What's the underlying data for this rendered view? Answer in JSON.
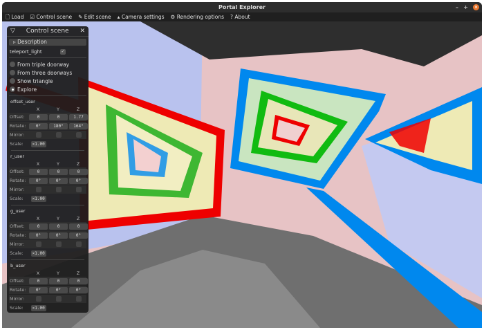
{
  "window": {
    "title": "Portal Explorer"
  },
  "menu": [
    {
      "icon": "file-icon",
      "label": "Load"
    },
    {
      "icon": "checkbox-icon",
      "label": "Control scene"
    },
    {
      "icon": "pencil-icon",
      "label": "Edit scene"
    },
    {
      "icon": "camera-icon",
      "label": "Camera settings"
    },
    {
      "icon": "gear-icon",
      "label": "Rendering options"
    },
    {
      "icon": "question-icon",
      "label": "About"
    }
  ],
  "panel": {
    "title": "Control scene",
    "description": "Description",
    "teleport_light": {
      "label": "teleport_light",
      "checked": true
    },
    "radios": [
      {
        "label": "From triple doorway",
        "selected": false
      },
      {
        "label": "From three doorways",
        "selected": false
      },
      {
        "label": "Show triangle",
        "selected": false
      },
      {
        "label": "Explore",
        "selected": true
      }
    ],
    "axes": [
      "X",
      "Y",
      "Z"
    ],
    "labels": {
      "offset": "Offset:",
      "rotate": "Rotate:",
      "mirror": "Mirror:",
      "scale": "Scale:"
    },
    "sections": [
      {
        "name": "offset_user",
        "offset": [
          "0",
          "0",
          "1.77"
        ],
        "rotate": [
          "0°",
          "180°",
          "164°"
        ],
        "scale": "×1.00"
      },
      {
        "name": "r_user",
        "offset": [
          "0",
          "0",
          "0"
        ],
        "rotate": [
          "0°",
          "0°",
          "0°"
        ],
        "scale": "×1.00"
      },
      {
        "name": "g_user",
        "offset": [
          "0",
          "0",
          "0"
        ],
        "rotate": [
          "0°",
          "0°",
          "0°"
        ],
        "scale": "×1.00"
      },
      {
        "name": "b_user",
        "offset": [
          "0",
          "0",
          "0"
        ],
        "rotate": [
          "0°",
          "0°",
          "0°"
        ],
        "scale": "×1.00"
      }
    ]
  }
}
